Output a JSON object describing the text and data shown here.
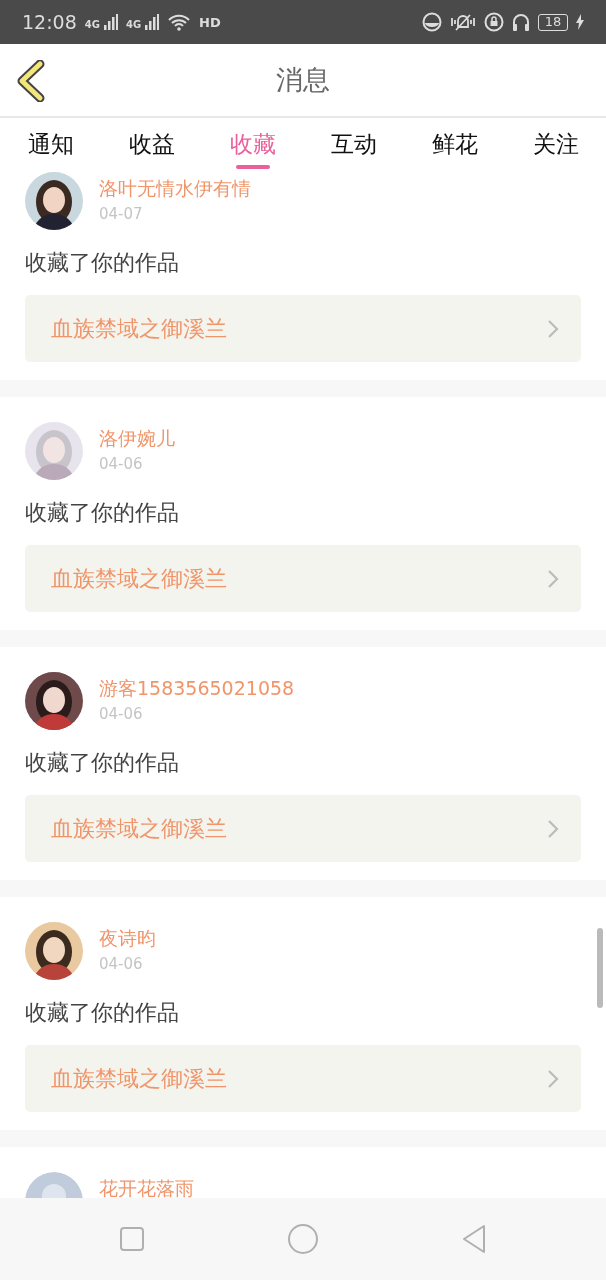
{
  "status_bar": {
    "time": "12:08",
    "networks": [
      "4G",
      "4G"
    ],
    "hd": "HD",
    "battery": "18"
  },
  "header": {
    "title": "消息"
  },
  "tabs": [
    {
      "label": "通知",
      "selected": false
    },
    {
      "label": "收益",
      "selected": false
    },
    {
      "label": "收藏",
      "selected": true
    },
    {
      "label": "互动",
      "selected": false
    },
    {
      "label": "鲜花",
      "selected": false
    },
    {
      "label": "关注",
      "selected": false
    }
  ],
  "messages": [
    {
      "name": "洛叶无情水伊有情",
      "date": "04-07",
      "text": "收藏了你的作品",
      "work": "血族禁域之御溪兰"
    },
    {
      "name": "洛伊婉儿",
      "date": "04-06",
      "text": "收藏了你的作品",
      "work": "血族禁域之御溪兰"
    },
    {
      "name": "游客1583565021058",
      "date": "04-06",
      "text": "收藏了你的作品",
      "work": "血族禁域之御溪兰"
    },
    {
      "name": "夜诗昀",
      "date": "04-06",
      "text": "收藏了你的作品",
      "work": "血族禁域之御溪兰"
    },
    {
      "avatar": {
        "kind": "default"
      },
      "name": "花开花落雨"
    }
  ]
}
